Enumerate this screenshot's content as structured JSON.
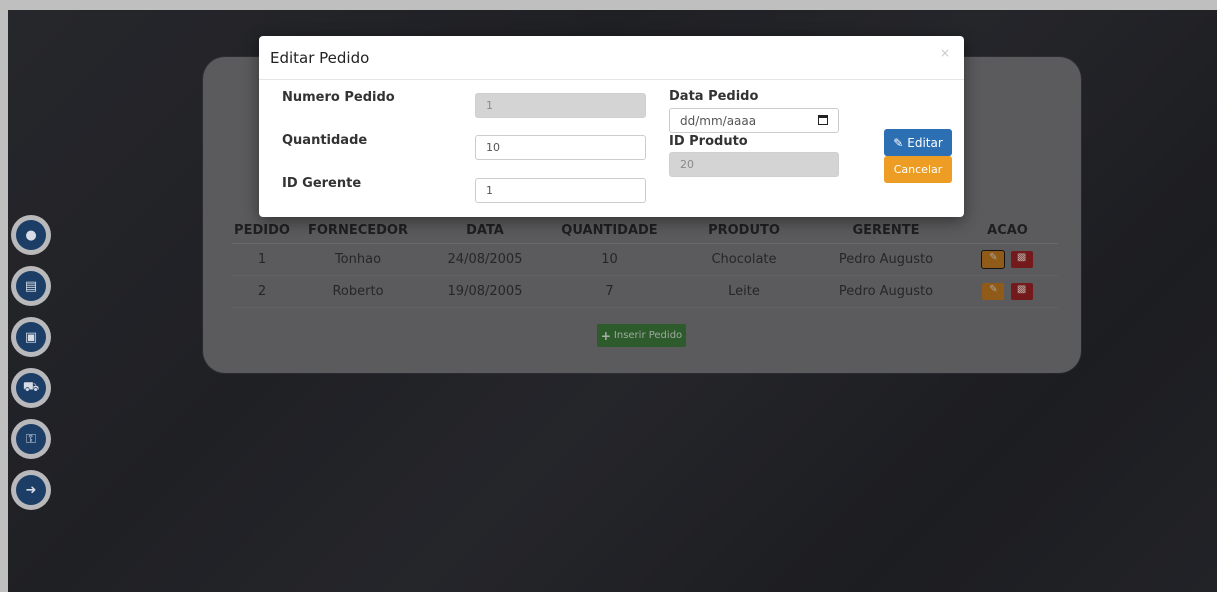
{
  "table": {
    "headers": [
      "PEDIDO",
      "FORNECEDOR",
      "DATA",
      "QUANTIDADE",
      "PRODUTO",
      "GERENTE",
      "ACAO"
    ],
    "rows": [
      {
        "pedido": "1",
        "fornecedor": "Tonhao",
        "data": "24/08/2005",
        "quantidade": "10",
        "produto": "Chocolate",
        "gerente": "Pedro Augusto"
      },
      {
        "pedido": "2",
        "fornecedor": "Roberto",
        "data": "19/08/2005",
        "quantidade": "7",
        "produto": "Leite",
        "gerente": "Pedro Augusto"
      }
    ]
  },
  "insert_button": {
    "label": "Inserir Pedido"
  },
  "sidebar": {
    "items": [
      {
        "icon": "user-icon"
      },
      {
        "icon": "document-icon"
      },
      {
        "icon": "archive-icon"
      },
      {
        "icon": "truck-icon"
      },
      {
        "icon": "unlock-icon"
      },
      {
        "icon": "logout-icon"
      }
    ]
  },
  "modal": {
    "title": "Editar Pedido",
    "close": "×",
    "numero_pedido": {
      "label": "Numero Pedido",
      "value": "1"
    },
    "quantidade": {
      "label": "Quantidade",
      "value": "10"
    },
    "id_gerente": {
      "label": "ID Gerente",
      "value": "1"
    },
    "data_pedido": {
      "label": "Data Pedido",
      "placeholder": "dd/mm/aaaa"
    },
    "id_produto": {
      "label": "ID Produto",
      "value": "20"
    },
    "editar_label": "Editar",
    "cancelar_label": "Cancelar"
  },
  "colors": {
    "primary": "#2c6fb3",
    "warning": "#ee9d24",
    "success": "#3c7a3a",
    "danger": "#9b2327"
  }
}
